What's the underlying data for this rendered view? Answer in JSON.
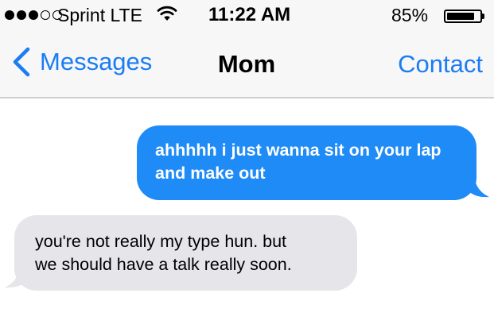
{
  "status_bar": {
    "signal_dots": [
      "filled",
      "filled",
      "filled",
      "empty",
      "empty"
    ],
    "carrier": "Sprint LTE",
    "wifi_icon": "wifi-icon",
    "time": "11:22 AM",
    "battery_percent": "85%",
    "battery_level": 0.85
  },
  "nav": {
    "back_label": "Messages",
    "title": "Mom",
    "contact_label": "Contact",
    "accent_color": "#1b7cf3"
  },
  "messages": [
    {
      "direction": "sent",
      "lines": [
        "ahhhhh i just wanna sit on your lap",
        "and make out"
      ],
      "bubble_color": "#1f8bf7"
    },
    {
      "direction": "received",
      "lines": [
        "you're not really my type hun. but",
        "we should have a talk really soon."
      ],
      "bubble_color": "#e5e5ea"
    }
  ]
}
